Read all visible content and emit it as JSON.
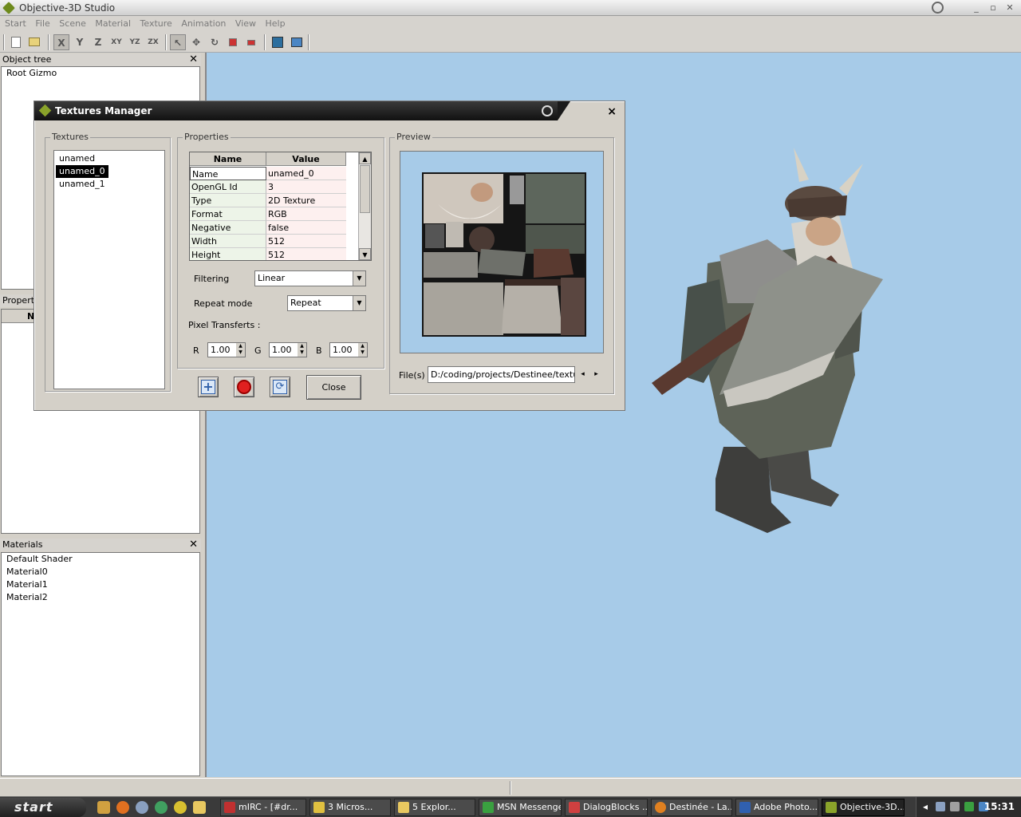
{
  "window": {
    "title": "Objective-3D Studio"
  },
  "menu": [
    "Start",
    "File",
    "Scene",
    "Material",
    "Texture",
    "Animation",
    "View",
    "Help"
  ],
  "toolbar": {
    "axis_x": "X",
    "axis_y": "Y",
    "axis_z": "Z",
    "plane_xy": "XY",
    "plane_yz": "YZ",
    "plane_zx": "ZX"
  },
  "object_tree": {
    "title": "Object tree",
    "items": [
      "Root Gizmo"
    ]
  },
  "properties_pane": {
    "title": "Properti",
    "col": "N"
  },
  "materials": {
    "title": "Materials",
    "items": [
      "Default Shader",
      "Material0",
      "Material1",
      "Material2"
    ]
  },
  "dialog": {
    "title": "Textures Manager",
    "close_glyph": "×",
    "textures_group": "Textures",
    "textures": [
      "unamed",
      "unamed_0",
      "unamed_1"
    ],
    "selected_texture": "unamed_0",
    "properties_group": "Properties",
    "grid_header": {
      "name": "Name",
      "value": "Value"
    },
    "properties": [
      {
        "name": "Name",
        "value": "unamed_0"
      },
      {
        "name": "OpenGL Id",
        "value": "3"
      },
      {
        "name": "Type",
        "value": "2D Texture"
      },
      {
        "name": "Format",
        "value": "RGB"
      },
      {
        "name": "Negative",
        "value": "false"
      },
      {
        "name": "Width",
        "value": "512"
      },
      {
        "name": "Height",
        "value": "512"
      }
    ],
    "filtering_label": "Filtering",
    "filtering_value": "Linear",
    "repeat_label": "Repeat mode",
    "repeat_value": "Repeat",
    "pixel_transfers_label": "Pixel Transferts :",
    "r_label": "R",
    "r_value": "1.00",
    "g_label": "G",
    "g_value": "1.00",
    "b_label": "B",
    "b_value": "1.00",
    "preview_group": "Preview",
    "files_label": "File(s)",
    "file_path": "D:/coding/projects/Destinee/texture",
    "close_button": "Close"
  },
  "taskbar": {
    "start": "start",
    "tasks": [
      {
        "label": "mIRC - [#dr...",
        "color": "#c03030"
      },
      {
        "label": "3 Micros...",
        "color": "#e0c040"
      },
      {
        "label": "5 Explor...",
        "color": "#e8c860"
      },
      {
        "label": "MSN Messenger",
        "color": "#3aa040"
      },
      {
        "label": "DialogBlocks ...",
        "color": "#d04040"
      },
      {
        "label": "Destinée - La...",
        "color": "#e08020"
      },
      {
        "label": "Adobe Photo...",
        "color": "#3060b0"
      },
      {
        "label": "Objective-3D...",
        "color": "#8aa32a"
      }
    ],
    "clock": "15:31"
  },
  "colors": {
    "viewport": "#a7cbe8",
    "dialog_title": "#1a1a1a"
  }
}
